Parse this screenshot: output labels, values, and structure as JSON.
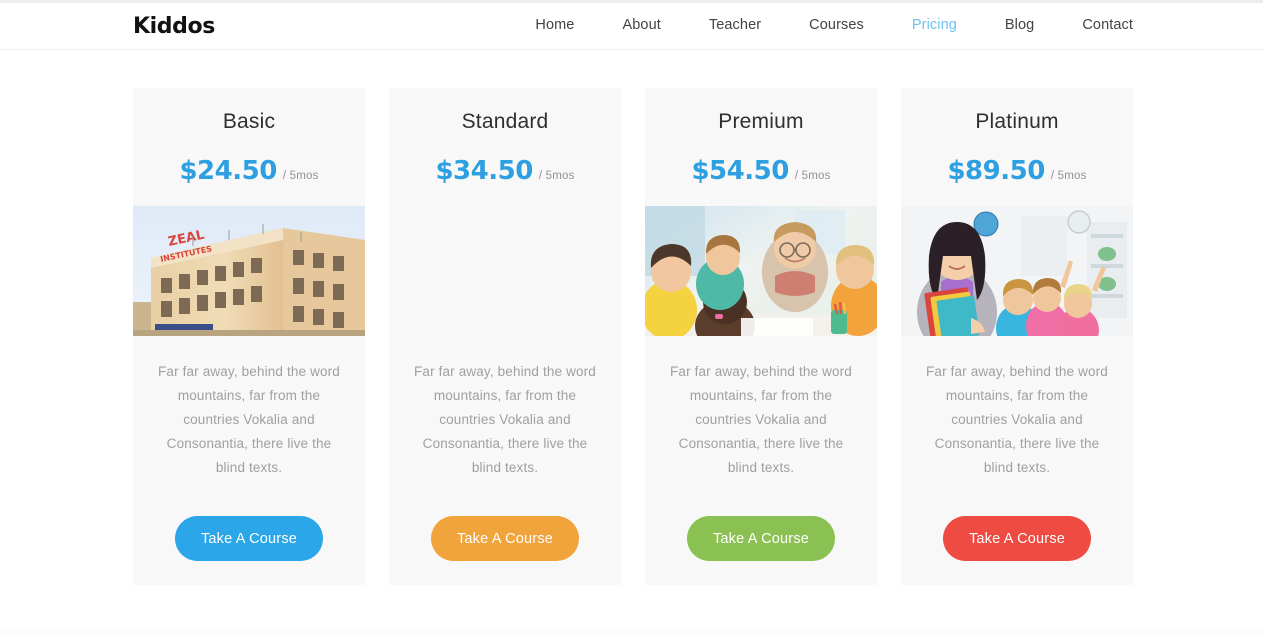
{
  "header": {
    "brand": "Kiddos",
    "nav": [
      {
        "label": "Home",
        "active": false
      },
      {
        "label": "About",
        "active": false
      },
      {
        "label": "Teacher",
        "active": false
      },
      {
        "label": "Courses",
        "active": false
      },
      {
        "label": "Pricing",
        "active": true
      },
      {
        "label": "Blog",
        "active": false
      },
      {
        "label": "Contact",
        "active": false
      }
    ],
    "active_color": "#6cc3f0"
  },
  "pricing": {
    "period_label": "/ 5mos",
    "price_color": "#2e9fe0",
    "card_bg": "#f8f8f8",
    "description": "Far far away, behind the word mountains, far from the countries Vokalia and Consonantia, there live the blind texts.",
    "cards": [
      {
        "title": "Basic",
        "price": "$24.50",
        "period": "/ 5mos",
        "image": "zeal-institutes-building-photo",
        "image_present": true,
        "button_label": "Take A Course",
        "button_color": "#2ba6e8"
      },
      {
        "title": "Standard",
        "price": "$34.50",
        "period": "/ 5mos",
        "image": "missing-image-placeholder",
        "image_present": false,
        "button_label": "Take A Course",
        "button_color": "#f1a33c"
      },
      {
        "title": "Premium",
        "price": "$54.50",
        "period": "/ 5mos",
        "image": "teacher-with-children-at-table-photo",
        "image_present": true,
        "button_label": "Take A Course",
        "button_color": "#8bc152"
      },
      {
        "title": "Platinum",
        "price": "$89.50",
        "period": "/ 5mos",
        "image": "teacher-holding-books-with-students-photo",
        "image_present": true,
        "button_label": "Take A Course",
        "button_color": "#ee4b42"
      }
    ]
  }
}
